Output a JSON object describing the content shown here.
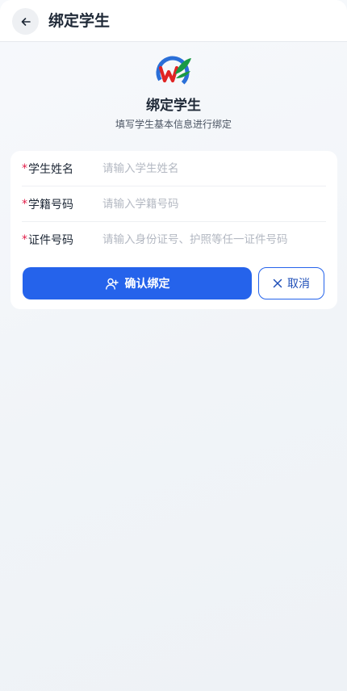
{
  "topbar": {
    "title": "绑定学生",
    "back_icon": "arrow-left-icon"
  },
  "header": {
    "logo": "school-logo",
    "title": "绑定学生",
    "subtitle": "填写学生基本信息进行绑定"
  },
  "form": {
    "fields": [
      {
        "label": "学生姓名",
        "required": true,
        "placeholder": "请输入学生姓名",
        "value": ""
      },
      {
        "label": "学籍号码",
        "required": true,
        "placeholder": "请输入学籍号码",
        "value": ""
      },
      {
        "label": "证件号码",
        "required": true,
        "placeholder": "请输入身份证号、护照等任一证件号码",
        "value": ""
      }
    ],
    "confirm_label": "确认绑定",
    "confirm_icon": "user-plus-icon",
    "cancel_label": "取消",
    "cancel_icon": "close-icon"
  },
  "colors": {
    "primary": "#2563eb",
    "required": "#e11d48",
    "background": "#f3f6f9"
  }
}
